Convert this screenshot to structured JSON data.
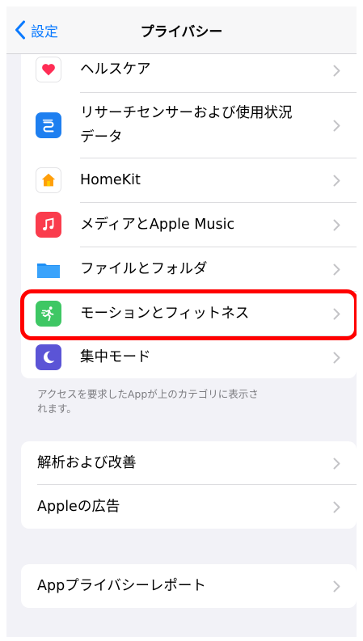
{
  "nav": {
    "back_label": "設定",
    "title": "プライバシー"
  },
  "privacy_items": [
    {
      "label": "ヘルスケア",
      "icon": "health-heart-icon"
    },
    {
      "label": "リサーチセンサーおよび使用状況",
      "label2": "データ",
      "icon": "research-sensor-icon"
    },
    {
      "label": "HomeKit",
      "icon": "homekit-icon"
    },
    {
      "label": "メディアとApple Music",
      "icon": "music-icon"
    },
    {
      "label": "ファイルとフォルダ",
      "icon": "folder-icon"
    },
    {
      "label": "モーションとフィットネス",
      "icon": "fitness-runner-icon"
    },
    {
      "label": "集中モード",
      "icon": "moon-icon"
    }
  ],
  "footnote": [
    "アクセスを要求したAppが上のカテゴリに表示さ",
    "れます。"
  ],
  "analytics_items": [
    {
      "label": "解析および改善"
    },
    {
      "label": "Appleの広告"
    }
  ],
  "report_items": [
    {
      "label": "Appプライバシーレポート"
    }
  ],
  "colors": {
    "accent": "#0a7aff",
    "highlight": "#ff0000",
    "health_icon_bg": "#ffffff",
    "research_icon_bg": "#1e7ff0",
    "homekit_icon_bg": "#ffffff",
    "music_icon_bg": "#fa3c4d",
    "folder_icon_bg": "#ffffff",
    "fitness_icon_bg": "#3ec764",
    "focus_icon_bg": "#5b54d6"
  }
}
